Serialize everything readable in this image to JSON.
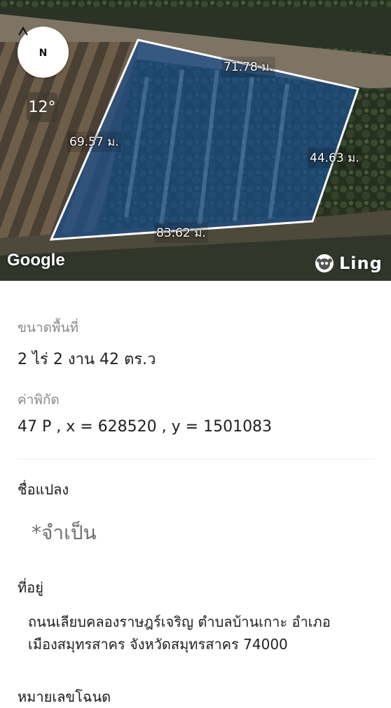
{
  "map": {
    "compass_label": "N",
    "rotation_label": "12°",
    "dimensions": {
      "top": "71.78 ม.",
      "left": "69.57 ม.",
      "right": "44.63 ม.",
      "bottom": "83.62 ม."
    },
    "attribution": "Google",
    "brand": "Ling",
    "colors": {
      "parcel_fill": "#1a4f8c",
      "parcel_outline": "#ffffff"
    }
  },
  "details": {
    "area_label": "ขนาดพื้นที่",
    "area_value": "2 ไร่ 2 งาน 42 ตร.ว",
    "coord_label": "ค่าพิกัด",
    "coord_value": "47 P , x = 628520 , y = 1501083",
    "plot_name_label": "ชื่อแปลง",
    "plot_name_placeholder": "*จำเป็น",
    "address_label": "ที่อยู่",
    "address_line1": "ถนนเลียบคลองราษฎร์เจริญ ตำบลบ้านเกาะ อำเภอ",
    "address_line2": "เมืองสมุทรสาคร จังหวัดสมุทรสาคร 74000",
    "deed_label": "หมายเลขโฉนด"
  }
}
